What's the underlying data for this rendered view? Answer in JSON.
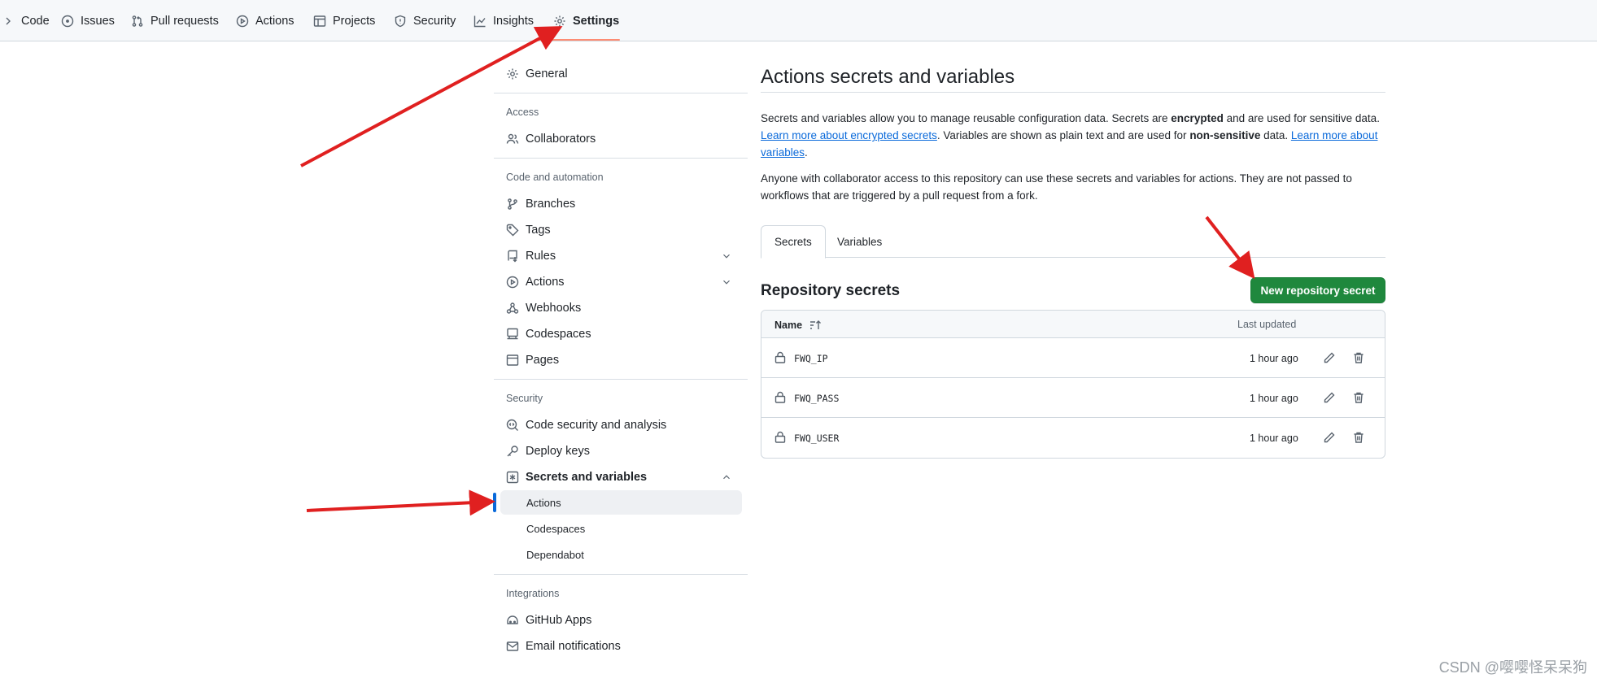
{
  "topnav": {
    "tabs": [
      {
        "label": "Code",
        "icon": "chevron-icon"
      },
      {
        "label": "Issues",
        "icon": "issue-icon"
      },
      {
        "label": "Pull requests",
        "icon": "pull-request-icon"
      },
      {
        "label": "Actions",
        "icon": "play-icon"
      },
      {
        "label": "Projects",
        "icon": "table-icon"
      },
      {
        "label": "Security",
        "icon": "shield-icon"
      },
      {
        "label": "Insights",
        "icon": "graph-icon"
      },
      {
        "label": "Settings",
        "icon": "gear-icon",
        "selected": true
      }
    ]
  },
  "sidebar": {
    "general": "General",
    "sections": {
      "access": "Access",
      "code_automation": "Code and automation",
      "security": "Security",
      "integrations": "Integrations"
    },
    "items": {
      "collaborators": "Collaborators",
      "branches": "Branches",
      "tags": "Tags",
      "rules": "Rules",
      "actions": "Actions",
      "webhooks": "Webhooks",
      "codespaces": "Codespaces",
      "pages": "Pages",
      "code_security": "Code security and analysis",
      "deploy_keys": "Deploy keys",
      "secrets_variables": "Secrets and variables",
      "sub_actions": "Actions",
      "sub_codespaces": "Codespaces",
      "sub_dependabot": "Dependabot",
      "github_apps": "GitHub Apps",
      "email_notifications": "Email notifications"
    }
  },
  "main": {
    "title": "Actions secrets and variables",
    "p1": {
      "t1": "Secrets and variables allow you to manage reusable configuration data. Secrets are ",
      "b1": "encrypted",
      "t2": " and are used for sensitive data. ",
      "link1": "Learn more about encrypted secrets",
      "t3": ". Variables are shown as plain text and are used for ",
      "b2": "non-sensitive",
      "t4": " data. ",
      "link2": "Learn more about variables",
      "t5": "."
    },
    "p2": "Anyone with collaborator access to this repository can use these secrets and variables for actions. They are not passed to workflows that are triggered by a pull request from a fork.",
    "tabs": [
      "Secrets",
      "Variables"
    ],
    "section_title": "Repository secrets",
    "new_button": "New repository secret",
    "table": {
      "col_name": "Name",
      "col_updated": "Last updated",
      "rows": [
        {
          "name": "FWQ_IP",
          "updated": "1 hour ago"
        },
        {
          "name": "FWQ_PASS",
          "updated": "1 hour ago"
        },
        {
          "name": "FWQ_USER",
          "updated": "1 hour ago"
        }
      ]
    }
  },
  "annotation_color": "#e02020",
  "watermark": "CSDN @嘤嘤怪呆呆狗"
}
